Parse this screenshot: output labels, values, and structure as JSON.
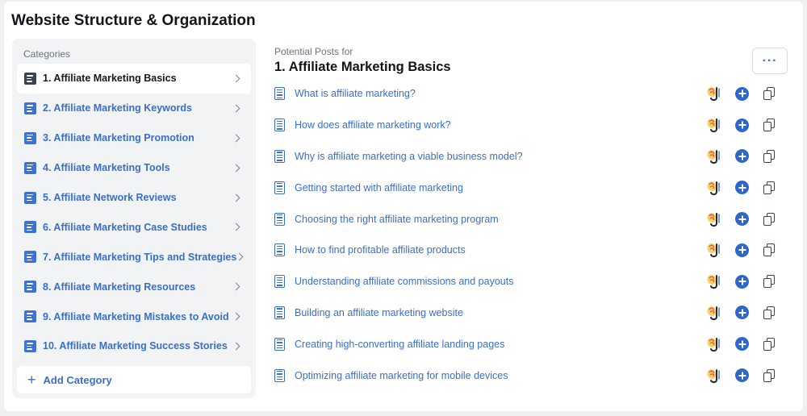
{
  "page_title": "Website Structure & Organization",
  "sidebar": {
    "heading": "Categories",
    "items": [
      {
        "label": "1. Affiliate Marketing Basics",
        "active": true
      },
      {
        "label": "2. Affiliate Marketing Keywords"
      },
      {
        "label": "3. Affiliate Marketing Promotion"
      },
      {
        "label": "4. Affiliate Marketing Tools"
      },
      {
        "label": "5. Affiliate Network Reviews"
      },
      {
        "label": "6. Affiliate Marketing Case Studies"
      },
      {
        "label": "7. Affiliate Marketing Tips and Strategies"
      },
      {
        "label": "8. Affiliate Marketing Resources"
      },
      {
        "label": "9. Affiliate Marketing Mistakes to Avoid"
      },
      {
        "label": "10. Affiliate Marketing Success Stories"
      }
    ],
    "add_label": "Add Category",
    "add_icon": "+"
  },
  "main": {
    "subheading": "Potential Posts for",
    "heading": "1. Affiliate Marketing Basics",
    "more_label": "···",
    "posts": [
      "What is affiliate marketing?",
      "How does affiliate marketing work?",
      "Why is affiliate marketing a viable business model?",
      "Getting started with affiliate marketing",
      "Choosing the right affiliate marketing program",
      "How to find profitable affiliate products",
      "Understanding affiliate commissions and payouts",
      "Building an affiliate marketing website",
      "Creating high-converting affiliate landing pages",
      "Optimizing affiliate marketing for mobile devices"
    ]
  },
  "colors": {
    "accent": "#3a6fc8",
    "sidebar_bg": "#f1f3f5",
    "active_icon": "#3c4350"
  },
  "icons": {
    "category": "document-lines-icon",
    "post": "document-icon",
    "generate": "magic-wand-icon",
    "add": "plus-circle-icon",
    "copy": "copy-icon"
  }
}
